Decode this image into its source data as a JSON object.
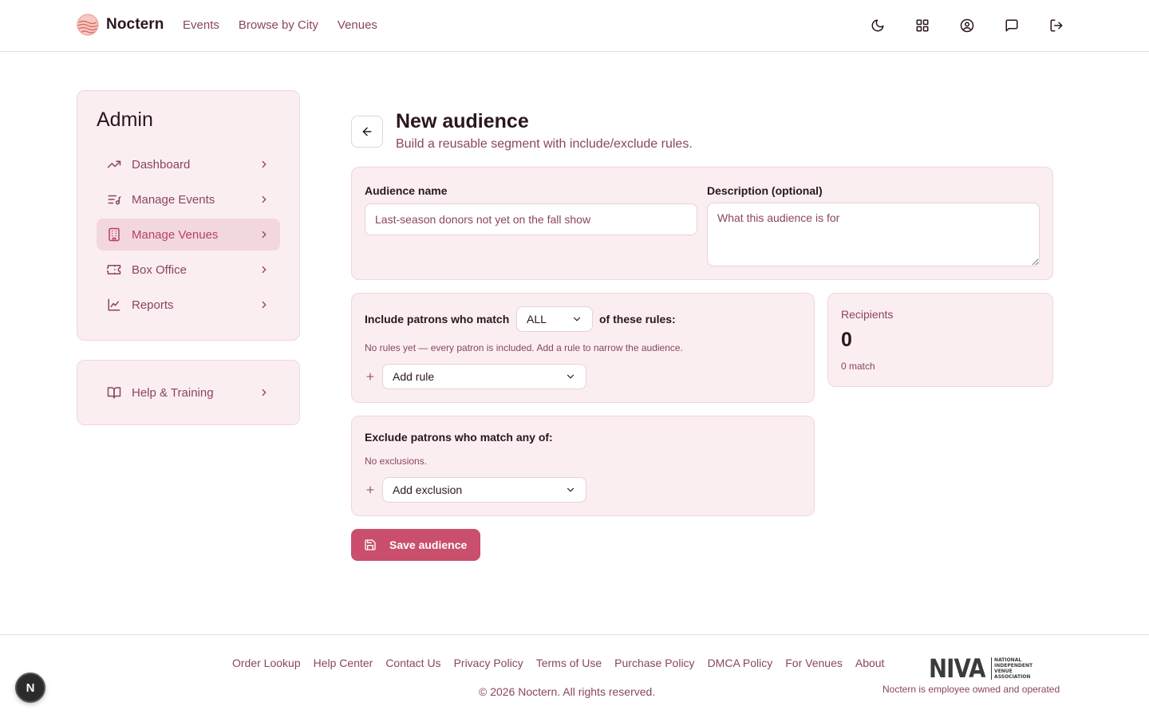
{
  "brand": {
    "name": "Noctern",
    "logo_icon": "waves-sun-logo"
  },
  "nav": {
    "links": [
      "Events",
      "Browse by City",
      "Venues"
    ]
  },
  "top_icons": [
    "moon-icon",
    "grid-icon",
    "user-circle-icon",
    "message-icon",
    "logout-icon"
  ],
  "sidebar": {
    "title": "Admin",
    "items": [
      {
        "label": "Dashboard",
        "icon": "trending-up-icon",
        "active": false
      },
      {
        "label": "Manage Events",
        "icon": "list-music-icon",
        "active": false
      },
      {
        "label": "Manage Venues",
        "icon": "building-icon",
        "active": true
      },
      {
        "label": "Box Office",
        "icon": "ticket-icon",
        "active": false
      },
      {
        "label": "Reports",
        "icon": "line-chart-icon",
        "active": false
      }
    ],
    "help": {
      "label": "Help & Training",
      "icon": "book-open-icon"
    }
  },
  "page": {
    "title": "New audience",
    "subtitle": "Build a reusable segment with include/exclude rules."
  },
  "form": {
    "name_label": "Audience name",
    "name_placeholder": "Last-season donors not yet on the fall show",
    "desc_label": "Description (optional)",
    "desc_placeholder": "What this audience is for"
  },
  "include": {
    "prefix": "Include patrons who match",
    "match_value": "ALL",
    "suffix": "of these rules:",
    "hint": "No rules yet — every patron is included. Add a rule to narrow the audience.",
    "add_label": "Add rule"
  },
  "exclude": {
    "heading": "Exclude patrons who match any of:",
    "hint": "No exclusions.",
    "add_label": "Add exclusion"
  },
  "recipients": {
    "label": "Recipients",
    "count": "0",
    "match": "0 match"
  },
  "save_label": "Save audience",
  "footer": {
    "links": [
      "Order Lookup",
      "Help Center",
      "Contact Us",
      "Privacy Policy",
      "Terms of Use",
      "Purchase Policy",
      "DMCA Policy",
      "For Venues",
      "About"
    ],
    "copyright": "© 2026 Noctern. All rights reserved.",
    "niva_word": "NIVA",
    "niva_sub": "NATIONAL INDEPENDENT VENUE ASSOCIATION",
    "tagline": "Noctern is employee owned and operated"
  },
  "dev_badge": "N",
  "colors": {
    "accent": "#c94f6c",
    "panel_bg": "#faeef1",
    "muted_text": "#8a4560",
    "active_item_bg": "#f3d7de"
  }
}
